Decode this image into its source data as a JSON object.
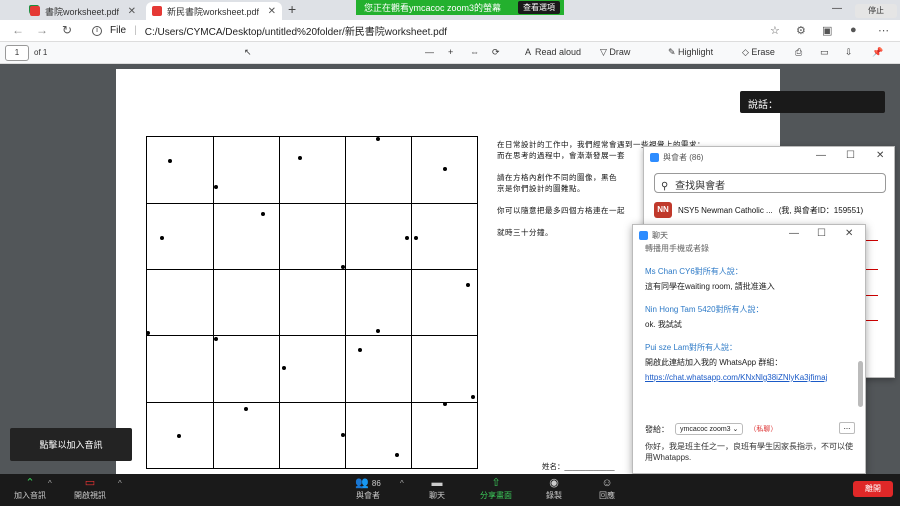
{
  "tabs": [
    {
      "title": "書院worksheet.pdf",
      "active": false
    },
    {
      "title": "新民書院worksheet.pdf",
      "active": true
    }
  ],
  "zoom_banner": {
    "text": "您正在觀看ymcacoc zoom3的螢幕",
    "view_options": "查看選項"
  },
  "stop_share": "停止",
  "address": {
    "scheme": "File",
    "path": "C:/Users/CYMCA/Desktop/untitled%20folder/新民書院worksheet.pdf"
  },
  "pdf_toolbar": {
    "page": "1",
    "total": "of 1",
    "read_aloud": "Read aloud",
    "draw": "Draw",
    "highlight": "Highlight",
    "erase": "Erase"
  },
  "worksheet": {
    "lines": [
      "在日常設計的工作中，我們經常會遇到一些視覺上的需求：",
      "而在思考的過程中，會漸漸發展一套",
      "請在方格內創作不同的圖像，黑色",
      "京是你們設計的圖難點。",
      "你可以隨意把最多四個方格連在一起",
      "就時三十分鐘。"
    ],
    "name_label": "姓名："
  },
  "chat_label": "說話：",
  "participants": {
    "title": "與會者 (86)",
    "search_placeholder": "查找與會者",
    "first_initials": "NN",
    "first_name": "NSY5 Newman Catholic ...",
    "first_suffix": "(我, 與會者ID：159551)"
  },
  "chat": {
    "title": "聊天",
    "top_partial": "轉播用手機或者錄",
    "messages": [
      {
        "sender": "Ms Chan CY6對所有人說：",
        "text": "這有同學在waiting room, 請批准進入"
      },
      {
        "sender": "Nin Hong Tam 5420對所有人說：",
        "text": "ok. 我試試"
      },
      {
        "sender": "Pui sze Lam對所有人說：",
        "text": "開啟此連結加入我的 WhatsApp 群組：",
        "link": "https://chat.whatsapp.com/KNxNlg38iZNlyKa3jfimaj"
      }
    ],
    "send_to_label": "發給：",
    "send_to_value": "ymcacoc zoom3",
    "private_label": "（私聊）",
    "more": "...",
    "note": "你好，我是班主任之一，良班有學生因家長指示，不可以使用Whatapps."
  },
  "audio_tooltip": "點擊以加入音訊",
  "zoom_toolbar": {
    "join_audio": "加入音訊",
    "start_video": "開啟視訊",
    "participants_label": "與會者",
    "participants_count": "86",
    "chat": "聊天",
    "share_screen": "分享畫面",
    "record": "錄製",
    "reactions": "回應",
    "leave": "離開"
  }
}
